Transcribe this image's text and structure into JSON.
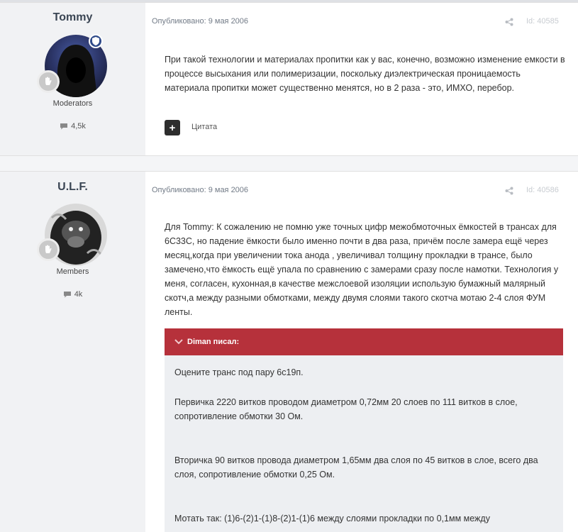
{
  "posts": [
    {
      "author": "Tommy",
      "group": "Moderators",
      "posts_count": "4,5k",
      "published": "Опубликовано: 9 мая 2006",
      "id_label": "Id: 40585",
      "body": "При такой технологии и материалах пропитки как у вас, конечно, возможно изменение емкости в процессе высыхания или полимеризации, поскольку диэлектрическая проницаемость материала пропитки может существенно менятся, но в 2 раза - это, ИМХО, перебор.",
      "quote_label": "Цитата",
      "plus_label": "+"
    },
    {
      "author": "U.L.F.",
      "group": "Members",
      "posts_count": "4k",
      "published": "Опубликовано: 9 мая 2006",
      "id_label": "Id: 40586",
      "body": "Для Tommy: К сожалению не помню уже точных цифр межобмоточных ёмкостей в трансах для 6С33С, но падение ёмкости было именно почти в два раза, причём после замера ещё через месяц,когда при увеличении тока анода , увеличивал толщину прокладки в трансе, было замечено,что ёмкость ещё упала по сравнению с замерами сразу после намотки. Технология у меня, согласен, кухонная,в качестве межслоевой изоляции использую бумажный малярный скотч,а между разными обмотками, между двумя слоями такого скотча мотаю 2-4 слоя ФУМ ленты.",
      "quote": {
        "header": "Diman писал:",
        "lines": [
          "Оцените транс под пару 6с19п.",
          "Первичка 2220 витков проводом диаметром 0,72мм 20 слоев по 111 витков в слое, сопротивление обмотки 30 Ом.",
          "Вторичка 90 витков провода диаметром 1,65мм два слоя по 45 витков в слое, всего два слоя, сопротивление обмотки 0,25 Ом.",
          "Мотать так: (1)6-(2)1-(1)8-(2)1-(1)6 между слоями прокладки по 0,1мм между"
        ]
      }
    }
  ],
  "colors": {
    "quote_header": "#b6313b",
    "mod_badge": "#2f4b8a"
  },
  "icons": [
    "share-icon",
    "comment-icon",
    "chevron-down-icon",
    "hand-icon",
    "shield-icon"
  ]
}
